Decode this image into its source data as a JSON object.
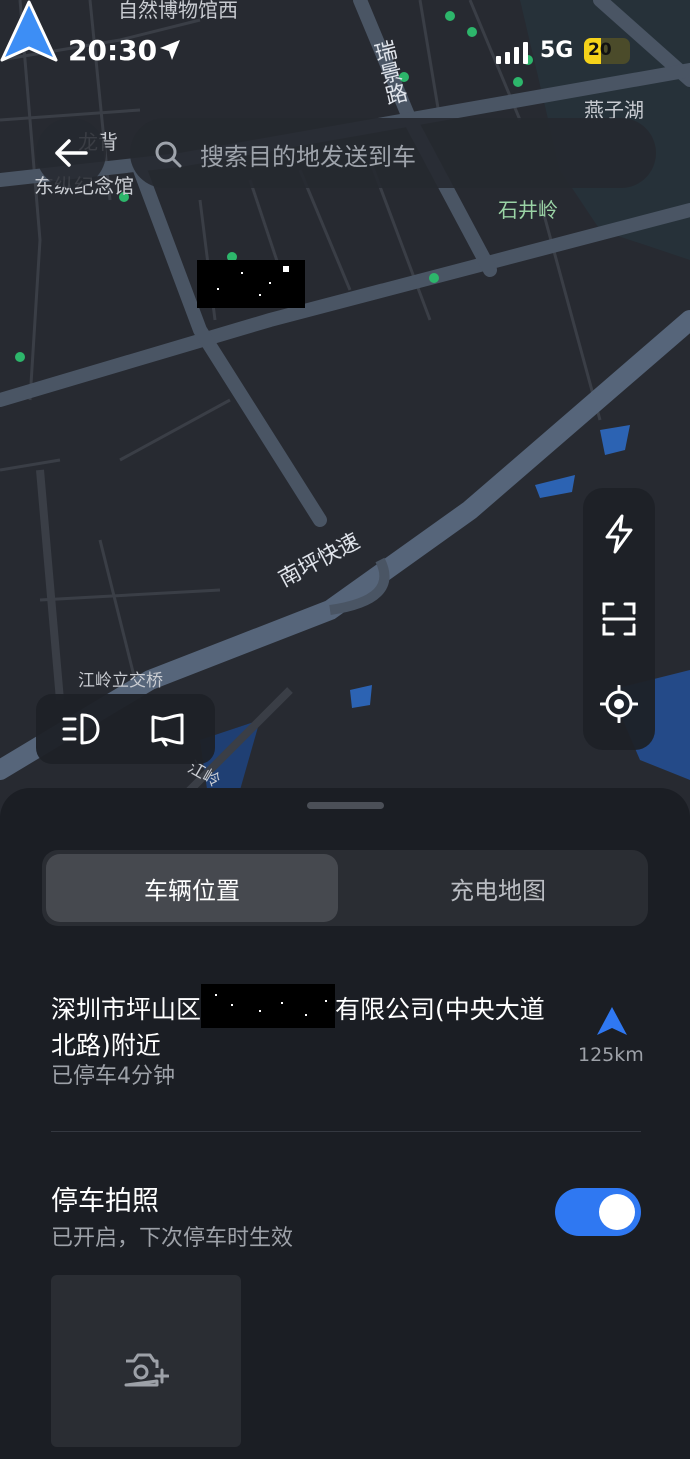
{
  "status_bar": {
    "time": "20:30",
    "network": "5G",
    "battery": "20"
  },
  "search": {
    "placeholder": "搜索目的地发送到车"
  },
  "map_labels": {
    "museum": "自然博物馆西",
    "ruijing_road": "瑞景路",
    "yanzihu": "燕子湖",
    "memorial_part1": "东纵纪念馆",
    "memorial_part2": "龙背",
    "shijingling": "石井岭",
    "nanping_expressway": "南坪快速",
    "jiangling_interchange": "江岭立交桥",
    "bottom_road": "江岭"
  },
  "tabs": [
    {
      "label": "车辆位置",
      "active": true
    },
    {
      "label": "充电地图",
      "active": false
    }
  ],
  "vehicle": {
    "address_prefix": "深圳市坪山区",
    "address_suffix": "有限公司(中央大道北路)附近",
    "parked": "已停车4分钟",
    "distance": "125km"
  },
  "parking_photo": {
    "title": "停车拍照",
    "subtitle": "已开启，下次停车时生效",
    "enabled": true
  },
  "colors": {
    "accent": "#2f78f2",
    "nav_arrow": "#3d8ef5",
    "map_bg": "#272a31"
  },
  "icons": [
    "back-arrow-icon",
    "search-icon",
    "lightning-icon",
    "scan-icon",
    "locate-icon",
    "headlight-icon",
    "horn-icon",
    "camera-add-icon"
  ]
}
